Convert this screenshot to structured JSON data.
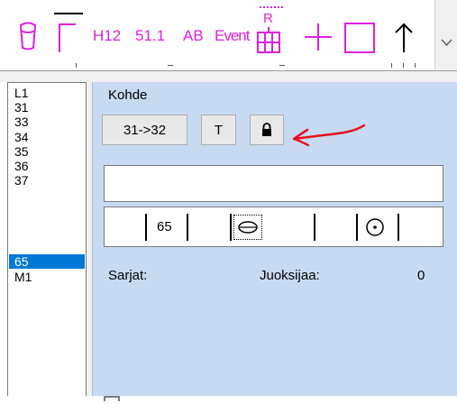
{
  "toolbar": {
    "items": [
      {
        "name": "cup-icon"
      },
      {
        "name": "corner-line-icon"
      },
      {
        "label": "H12"
      },
      {
        "label": "51.1"
      },
      {
        "label": "AB"
      },
      {
        "label": "Event"
      },
      {
        "name": "relay-grid-icon",
        "label": "R"
      },
      {
        "name": "plus-icon"
      },
      {
        "name": "square-icon"
      },
      {
        "name": "up-arrow-icon"
      }
    ],
    "accent_color": "#e020e0",
    "scroll_icon": "chevron-down-icon"
  },
  "controls_list": {
    "items": [
      "L1",
      "31",
      "33",
      "34",
      "35",
      "36",
      "37",
      "65",
      "M1"
    ],
    "selected": "65"
  },
  "target_panel": {
    "title": "Kohde",
    "leg_button": "31->32",
    "t_button": "T",
    "lock_icon": "lock-icon",
    "annotation": "red-arrow-icon",
    "name_value": "",
    "legs_value": "65",
    "sarjat_label": "Sarjat:",
    "runners_label": "Juoksijaa:",
    "runners_count": "0",
    "panel_color": "#c8daf2",
    "selection_color": "#0078d7",
    "annotation_color": "#e8101a"
  }
}
